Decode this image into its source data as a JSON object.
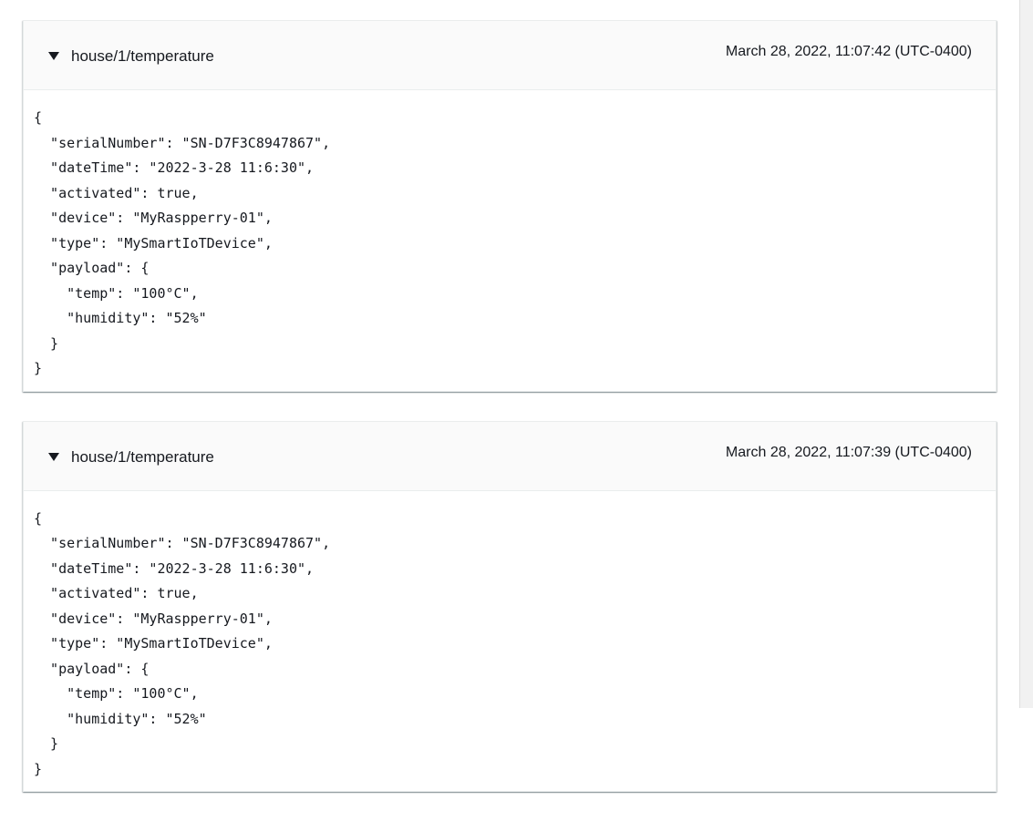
{
  "messages": [
    {
      "topic": "house/1/temperature",
      "timestamp": "March 28, 2022, 11:07:42 (UTC-0400)",
      "payload_text": "{\n  \"serialNumber\": \"SN-D7F3C8947867\",\n  \"dateTime\": \"2022-3-28 11:6:30\",\n  \"activated\": true,\n  \"device\": \"MyRaspperry-01\",\n  \"type\": \"MySmartIoTDevice\",\n  \"payload\": {\n    \"temp\": \"100°C\",\n    \"humidity\": \"52%\"\n  }\n}"
    },
    {
      "topic": "house/1/temperature",
      "timestamp": "March 28, 2022, 11:07:39 (UTC-0400)",
      "payload_text": "{\n  \"serialNumber\": \"SN-D7F3C8947867\",\n  \"dateTime\": \"2022-3-28 11:6:30\",\n  \"activated\": true,\n  \"device\": \"MyRaspperry-01\",\n  \"type\": \"MySmartIoTDevice\",\n  \"payload\": {\n    \"temp\": \"100°C\",\n    \"humidity\": \"52%\"\n  }\n}"
    }
  ],
  "icons": {
    "expand": "caret-down-icon"
  },
  "colors": {
    "header_bg": "#fafafa",
    "border": "#eaeded",
    "text": "#16191f"
  }
}
